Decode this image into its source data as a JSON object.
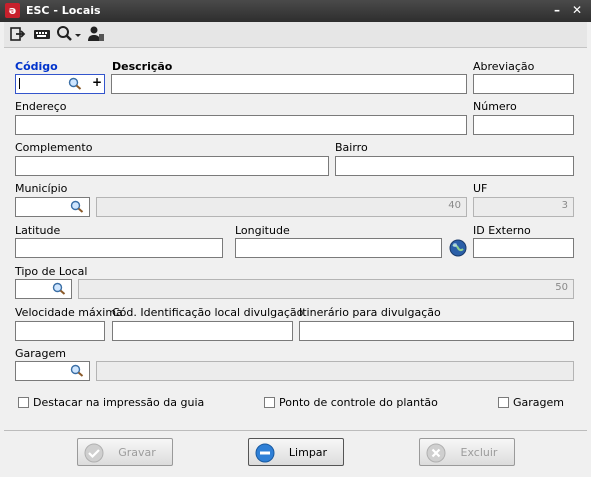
{
  "window": {
    "title": "ESC - Locais",
    "app_icon_letter": "ǝ",
    "minimize": "–",
    "close": "✕"
  },
  "toolbar": {
    "icons": [
      "exit-icon",
      "keyboard-icon",
      "search-dropdown-icon",
      "user-icon"
    ]
  },
  "form": {
    "codigo_label": "Código",
    "descricao_label": "Descrição",
    "abreviacao_label": "Abreviação",
    "endereco_label": "Endereço",
    "numero_label": "Número",
    "complemento_label": "Complemento",
    "bairro_label": "Bairro",
    "municipio_label": "Município",
    "municipio_maxlen": "40",
    "uf_label": "UF",
    "uf_maxlen": "3",
    "latitude_label": "Latitude",
    "longitude_label": "Longitude",
    "id_externo_label": "ID Externo",
    "tipo_local_label": "Tipo de Local",
    "tipo_local_maxlen": "50",
    "velocidade_label": "Velocidade máxima",
    "cod_ident_label": "Cód. Identificação local divulgação",
    "itinerario_label": "Itinerário para divulgação",
    "garagem_label": "Garagem",
    "plus_symbol": "+"
  },
  "checkboxes": {
    "destacar": "Destacar na impressão da guia",
    "ponto_controle": "Ponto de controle do plantão",
    "garagem": "Garagem"
  },
  "buttons": {
    "gravar": "Gravar",
    "limpar": "Limpar",
    "excluir": "Excluir"
  },
  "colors": {
    "required_label": "#0033cc",
    "title_bar": "#3a3a3a",
    "app_icon": "#c8202c"
  }
}
